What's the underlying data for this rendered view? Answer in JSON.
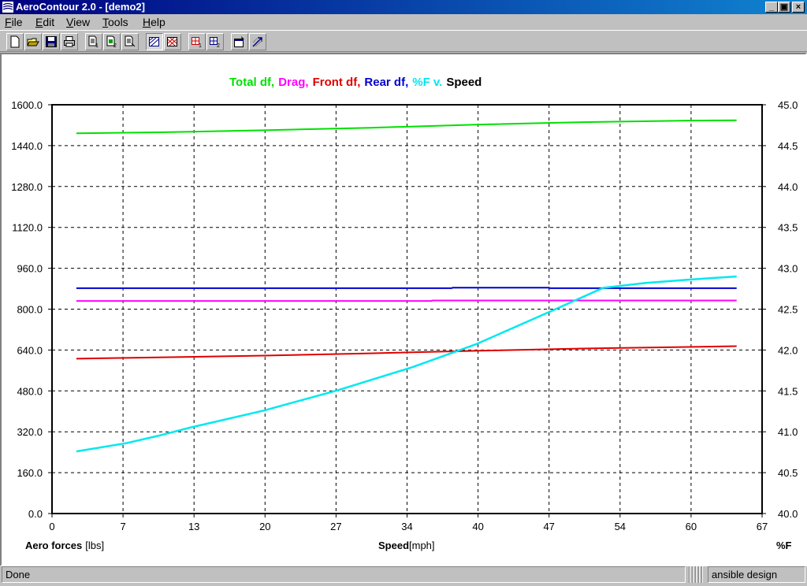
{
  "window": {
    "title": "AeroContour 2.0 - [demo2]",
    "min_label": "_",
    "restore_label": "▣",
    "close_label": "×"
  },
  "menu": [
    {
      "name": "file",
      "label": "File",
      "hotkey": "F",
      "rest": "ile"
    },
    {
      "name": "edit",
      "label": "Edit",
      "hotkey": "E",
      "rest": "dit"
    },
    {
      "name": "view",
      "label": "View",
      "hotkey": "V",
      "rest": "iew"
    },
    {
      "name": "tools",
      "label": "Tools",
      "hotkey": "T",
      "rest": "ools"
    },
    {
      "name": "help",
      "label": "Help",
      "hotkey": "H",
      "rest": "elp"
    }
  ],
  "toolbar": {
    "icons": [
      "new-file-icon",
      "open-folder-icon",
      "save-disk-icon",
      "print-icon",
      "document-1-icon",
      "document-2-icon",
      "document-3-icon",
      "hatch-pattern-icon",
      "crosshatch-pattern-icon",
      "grid-1-icon",
      "grid-2-icon",
      "properties-icon",
      "zoom-arrow-icon"
    ],
    "pressed": "hatch-pattern-icon"
  },
  "chart_data": {
    "type": "line",
    "title_parts": [
      {
        "text": "Total df,",
        "color": "#00e000"
      },
      {
        "text": "Drag,",
        "color": "#ff00ff"
      },
      {
        "text": "Front df,",
        "color": "#e00000"
      },
      {
        "text": "Rear df,",
        "color": "#0000d0"
      },
      {
        "text": "%F v.",
        "color": "#00e8f0"
      },
      {
        "text": "Speed",
        "color": "#000000"
      }
    ],
    "xlabel": "Speed",
    "xunit": "[mph]",
    "ylabel": "Aero forces",
    "yunit": "[lbs]",
    "y2label": "%F",
    "xlim": [
      0,
      67
    ],
    "ylim": [
      0,
      1600
    ],
    "y2lim": [
      40.0,
      45.0
    ],
    "x_ticks": [
      "0",
      "7",
      "13",
      "20",
      "27",
      "34",
      "40",
      "47",
      "54",
      "60",
      "67"
    ],
    "y_ticks": [
      "0.0",
      "160.0",
      "320.0",
      "480.0",
      "640.0",
      "800.0",
      "960.0",
      "1120.0",
      "1280.0",
      "1440.0",
      "1600.0"
    ],
    "y2_ticks": [
      "40.0",
      "40.5",
      "41.0",
      "41.5",
      "42.0",
      "42.5",
      "43.0",
      "43.5",
      "44.0",
      "44.5",
      "45.0"
    ],
    "grid": true,
    "series": [
      {
        "name": "Total df",
        "axis": "left",
        "color": "#00e000",
        "x": [
          2.3,
          10,
          20,
          30,
          40,
          50,
          60,
          64.6
        ],
        "y": [
          1488,
          1492,
          1500,
          1510,
          1522,
          1532,
          1538,
          1539
        ]
      },
      {
        "name": "Drag",
        "axis": "left",
        "color": "#ff00ff",
        "x": [
          2.3,
          35.8,
          35.9,
          64.6
        ],
        "y": [
          832,
          832,
          834,
          834
        ]
      },
      {
        "name": "Front df",
        "axis": "left",
        "color": "#e00000",
        "x": [
          2.3,
          10,
          20,
          30,
          40,
          50,
          60,
          64.6
        ],
        "y": [
          606,
          611,
          618,
          627,
          637,
          646,
          652,
          655
        ]
      },
      {
        "name": "Rear df",
        "axis": "left",
        "color": "#0000d0",
        "x": [
          2.3,
          37.7,
          37.8,
          46.9,
          47.0,
          64.6
        ],
        "y": [
          882,
          882,
          884,
          884,
          882,
          882
        ]
      },
      {
        "name": "%F",
        "axis": "right",
        "color": "#00e8f0",
        "x": [
          2.3,
          7,
          10,
          13,
          20,
          27,
          34,
          40,
          47,
          52,
          56,
          60,
          64.6
        ],
        "y": [
          40.76,
          40.86,
          40.95,
          41.05,
          41.26,
          41.51,
          41.79,
          42.07,
          42.47,
          42.76,
          42.82,
          42.86,
          42.9
        ]
      }
    ]
  },
  "status": {
    "text": "Done",
    "brand": "ansible design"
  }
}
